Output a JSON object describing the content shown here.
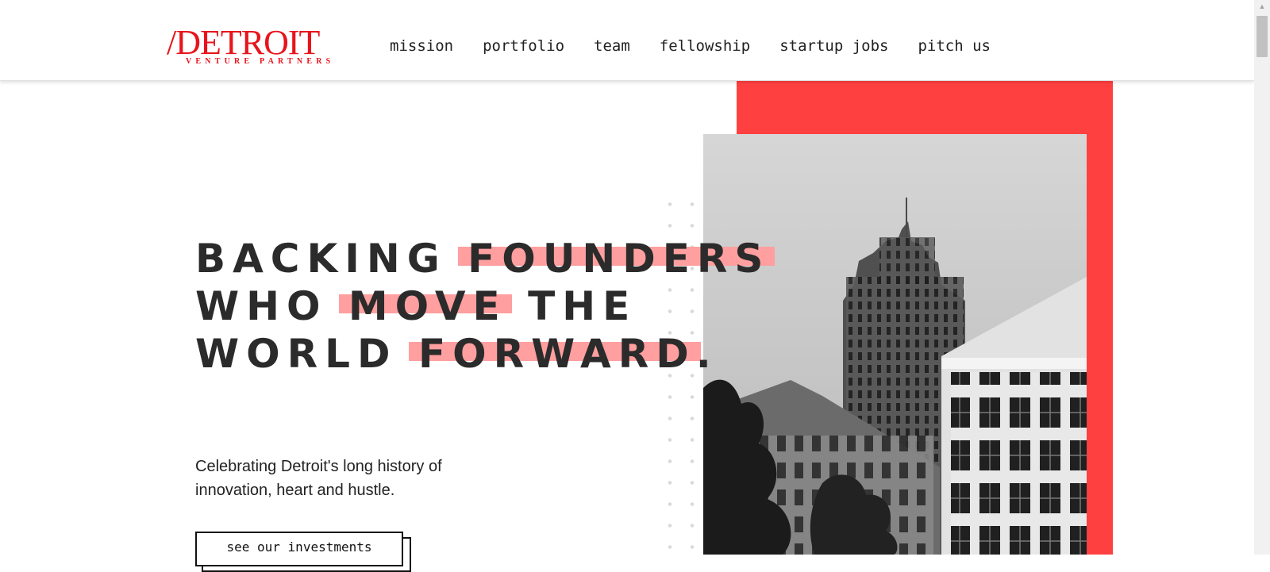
{
  "logo": {
    "main": "/DETROIT",
    "sub": "VENTURE PARTNERS"
  },
  "nav": {
    "items": [
      {
        "label": "mission"
      },
      {
        "label": "portfolio"
      },
      {
        "label": "team"
      },
      {
        "label": "fellowship"
      },
      {
        "label": "startup jobs"
      },
      {
        "label": "pitch us"
      }
    ]
  },
  "hero": {
    "line1": {
      "a": "BACKING ",
      "b": "FOUNDERS"
    },
    "line2": {
      "a": "WHO ",
      "b": "MOVE",
      "c": " THE"
    },
    "line3": {
      "a": "WORLD ",
      "b": "FORWARD",
      "c": "."
    },
    "subtitle": "Celebrating Detroit's long history of innovation, heart and hustle.",
    "cta_label": "see our investments"
  },
  "colors": {
    "accent_red": "#ff4040",
    "highlight": "#ff9f9f",
    "logo_red": "#e8141c",
    "text": "#2b2b2b"
  },
  "icons": {
    "scroll_up": "triangle-up-icon",
    "photo": "detroit-skyline-image"
  }
}
